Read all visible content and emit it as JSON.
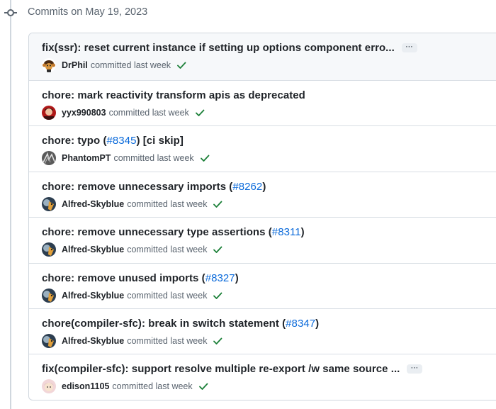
{
  "group": {
    "header": "Commits on May 19, 2023"
  },
  "colors": {
    "check": "#1a7f37",
    "link": "#0969da"
  },
  "commits": [
    {
      "prefix": "fix(ssr): reset current instance if setting up options component erro...",
      "pr": "",
      "suffix": "",
      "has_ellipsis": true,
      "ellipsis": "···",
      "author": "DrPhil",
      "meta": "committed last week",
      "avatar": "monkey-avatar"
    },
    {
      "prefix": "chore: mark reactivity transform apis as deprecated",
      "pr": "",
      "suffix": "",
      "has_ellipsis": false,
      "author": "yyx990803",
      "meta": "committed last week",
      "avatar": "red-portrait-avatar"
    },
    {
      "prefix": "chore: typo (",
      "pr": "#8345",
      "suffix": ") [ci skip]",
      "has_ellipsis": false,
      "author": "PhantomPT",
      "meta": "committed last week",
      "avatar": "sketch-avatar"
    },
    {
      "prefix": "chore: remove unnecessary imports (",
      "pr": "#8262",
      "suffix": ")",
      "has_ellipsis": false,
      "author": "Alfred-Skyblue",
      "meta": "committed last week",
      "avatar": "dark-character-avatar"
    },
    {
      "prefix": "chore: remove unnecessary type assertions (",
      "pr": "#8311",
      "suffix": ")",
      "has_ellipsis": false,
      "author": "Alfred-Skyblue",
      "meta": "committed last week",
      "avatar": "dark-character-avatar"
    },
    {
      "prefix": "chore: remove unused imports (",
      "pr": "#8327",
      "suffix": ")",
      "has_ellipsis": false,
      "author": "Alfred-Skyblue",
      "meta": "committed last week",
      "avatar": "dark-character-avatar"
    },
    {
      "prefix": "chore(compiler-sfc): break in switch statement (",
      "pr": "#8347",
      "suffix": ")",
      "has_ellipsis": false,
      "author": "Alfred-Skyblue",
      "meta": "committed last week",
      "avatar": "dark-character-avatar"
    },
    {
      "prefix": "fix(compiler-sfc): support resolve multiple re-export /w same source ...",
      "pr": "",
      "suffix": "",
      "has_ellipsis": true,
      "ellipsis": "···",
      "author": "edison1105",
      "meta": "committed last week",
      "avatar": "pink-character-avatar"
    }
  ]
}
